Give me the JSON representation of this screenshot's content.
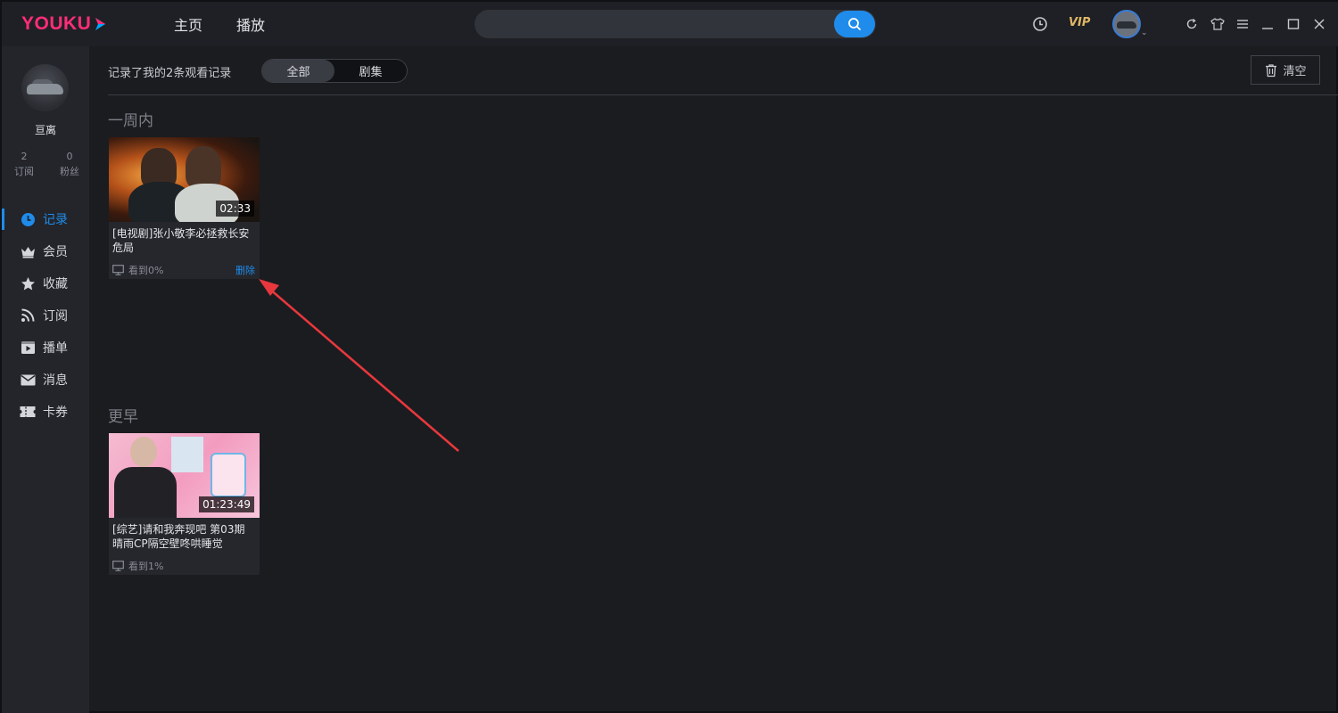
{
  "app": {
    "logo": "YOUKU",
    "nav": [
      "主页",
      "播放"
    ],
    "vip_label": "VIP"
  },
  "sidebar": {
    "username": "亘离",
    "stats": [
      {
        "value": "2",
        "label": "订阅"
      },
      {
        "value": "0",
        "label": "粉丝"
      }
    ],
    "items": [
      {
        "label": "记录",
        "icon": "clock-icon",
        "active": true
      },
      {
        "label": "会员",
        "icon": "crown-icon",
        "active": false
      },
      {
        "label": "收藏",
        "icon": "star-icon",
        "active": false
      },
      {
        "label": "订阅",
        "icon": "rss-icon",
        "active": false
      },
      {
        "label": "播单",
        "icon": "playlist-icon",
        "active": false
      },
      {
        "label": "消息",
        "icon": "mail-icon",
        "active": false
      },
      {
        "label": "卡券",
        "icon": "ticket-icon",
        "active": false
      }
    ]
  },
  "main": {
    "summary": "记录了我的2条观看记录",
    "filters": [
      {
        "label": "全部",
        "selected": true
      },
      {
        "label": "剧集",
        "selected": false
      }
    ],
    "clear_label": "清空",
    "sections": [
      {
        "title": "一周内",
        "cards": [
          {
            "duration": "02:33",
            "title": "[电视剧]张小敬李必拯救长安危局",
            "progress": "看到0%",
            "delete_label": "删除"
          }
        ]
      },
      {
        "title": "更早",
        "cards": [
          {
            "duration": "01:23:49",
            "title": "[综艺]请和我奔现吧 第03期 晴雨CP隔空壁咚哄睡觉",
            "progress": "看到1%"
          }
        ]
      }
    ]
  },
  "colors": {
    "accent": "#1f8ceb",
    "brand": "#ff2d78",
    "vip": "#e0b766",
    "annotation_arrow": "#e8383d"
  }
}
